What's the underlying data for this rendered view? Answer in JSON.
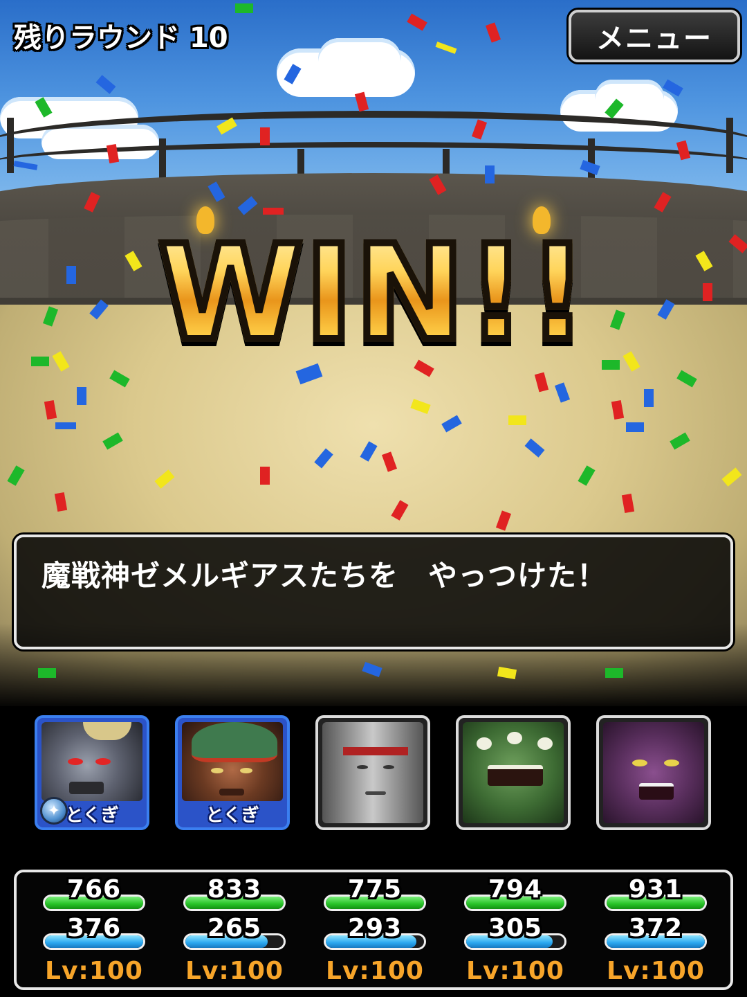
{
  "hud": {
    "rounds_label": "残りラウンド 10",
    "menu_label": "メニュー"
  },
  "banner": {
    "text": "WIN!!"
  },
  "message": {
    "text": "魔戦神ゼメルギアスたちを　やっつけた！"
  },
  "party": [
    {
      "tag": "とくぎ",
      "has_gem": true,
      "hp": "766",
      "mp": "376",
      "hp_fill": 1.0,
      "mp_fill": 1.0,
      "level": "Lv:100",
      "face_color": "#6a6f7d",
      "accent": "#c9b36a"
    },
    {
      "tag": "とくぎ",
      "has_gem": false,
      "hp": "833",
      "mp": "265",
      "hp_fill": 1.0,
      "mp_fill": 0.84,
      "level": "Lv:100",
      "face_color": "#3f7a4e",
      "accent": "#c23a24"
    },
    {
      "tag": "",
      "has_gem": false,
      "hp": "775",
      "mp": "293",
      "hp_fill": 1.0,
      "mp_fill": 0.92,
      "level": "Lv:100",
      "face_color": "#7a7a7a",
      "accent": "#b02222"
    },
    {
      "tag": "",
      "has_gem": false,
      "hp": "794",
      "mp": "305",
      "hp_fill": 1.0,
      "mp_fill": 0.88,
      "level": "Lv:100",
      "face_color": "#3d6b33",
      "accent": "#a6c26b"
    },
    {
      "tag": "",
      "has_gem": false,
      "hp": "931",
      "mp": "372",
      "hp_fill": 1.0,
      "mp_fill": 1.0,
      "level": "Lv:100",
      "face_color": "#5a2f5e",
      "accent": "#d9c14a"
    }
  ],
  "colors": {
    "win_gold": "#f4ad1c",
    "hp_green": "#27c227",
    "mp_blue": "#2aa7ef",
    "level_orange": "#f7a52a",
    "tokugi_blue": "#3b7ff0"
  }
}
